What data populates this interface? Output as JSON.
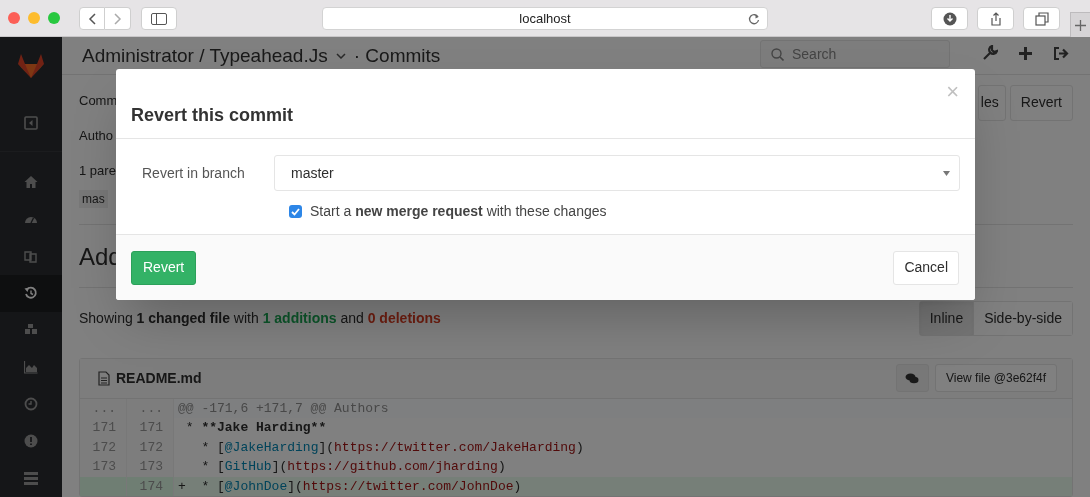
{
  "browser": {
    "url": "localhost"
  },
  "header": {
    "project": "Administrator / Typeahead.Js",
    "section": "· Commits",
    "search_placeholder": "Search"
  },
  "sidebar": {
    "items": [
      {
        "kind": "toggle",
        "selected": false
      },
      {
        "kind": "home",
        "selected": false
      },
      {
        "kind": "dashboard",
        "selected": false
      },
      {
        "kind": "files",
        "selected": false
      },
      {
        "kind": "history",
        "selected": true
      },
      {
        "kind": "cubes",
        "selected": false
      },
      {
        "kind": "chart",
        "selected": false
      },
      {
        "kind": "clock",
        "selected": false
      },
      {
        "kind": "alert",
        "selected": false
      },
      {
        "kind": "bars",
        "selected": false
      }
    ]
  },
  "commit": {
    "lines": [
      "Comm",
      "Autho",
      "1 pare"
    ],
    "branch": "mas",
    "heading": "Add",
    "buttons": [
      "les",
      "Revert"
    ]
  },
  "modal": {
    "title": "Revert this commit",
    "close": "×",
    "branch_label": "Revert in branch",
    "branch_value": "master",
    "merge_request": {
      "checked": true,
      "text": "Start a **new merge request** with these changes"
    },
    "submit": "Revert",
    "cancel": "Cancel"
  },
  "diff_stats": [
    {
      "kind": "plain",
      "text": "Showing"
    },
    {
      "kind": "bold",
      "text": "1 changed file"
    },
    {
      "kind": "plain",
      "text": "with"
    },
    {
      "kind": "added",
      "text": "1 additions"
    },
    {
      "kind": "plain",
      "text": "and"
    },
    {
      "kind": "deleted",
      "text": "0 deletions"
    }
  ],
  "view_modes": [
    {
      "label": "Inline",
      "selected": true
    },
    {
      "label": "Side-by-side",
      "selected": false
    }
  ],
  "file": {
    "name": "README.md",
    "view_button": "View file @3e62f4f",
    "lines": [
      {
        "kind": "hunk",
        "old": "...",
        "new": "...",
        "segments": [
          {
            "kind": "plain",
            "text": "@@ -171,6 +171,7 @@ Authors"
          }
        ]
      },
      {
        "kind": "context",
        "old": "171",
        "new": "171",
        "segments": [
          {
            "kind": "plain",
            "text": " * "
          },
          {
            "kind": "strong",
            "text": "**Jake Harding**"
          }
        ]
      },
      {
        "kind": "context",
        "old": "172",
        "new": "172",
        "segments": [
          {
            "kind": "plain",
            "text": "   * ["
          },
          {
            "kind": "link",
            "text": "@JakeHarding"
          },
          {
            "kind": "plain",
            "text": "]("
          },
          {
            "kind": "url",
            "text": "https://twitter.com/JakeHarding"
          },
          {
            "kind": "plain",
            "text": ")"
          }
        ]
      },
      {
        "kind": "context",
        "old": "173",
        "new": "173",
        "segments": [
          {
            "kind": "plain",
            "text": "   * ["
          },
          {
            "kind": "link",
            "text": "GitHub"
          },
          {
            "kind": "plain",
            "text": "]("
          },
          {
            "kind": "url",
            "text": "https://github.com/jharding"
          },
          {
            "kind": "plain",
            "text": ")"
          }
        ]
      },
      {
        "kind": "added",
        "new": "174",
        "segments": [
          {
            "kind": "plain",
            "text": "+  * ["
          },
          {
            "kind": "link",
            "text": "@JohnDoe"
          },
          {
            "kind": "plain",
            "text": "]("
          },
          {
            "kind": "url",
            "text": "https://twitter.com/JohnDoe"
          },
          {
            "kind": "plain",
            "text": ")"
          }
        ]
      }
    ]
  }
}
